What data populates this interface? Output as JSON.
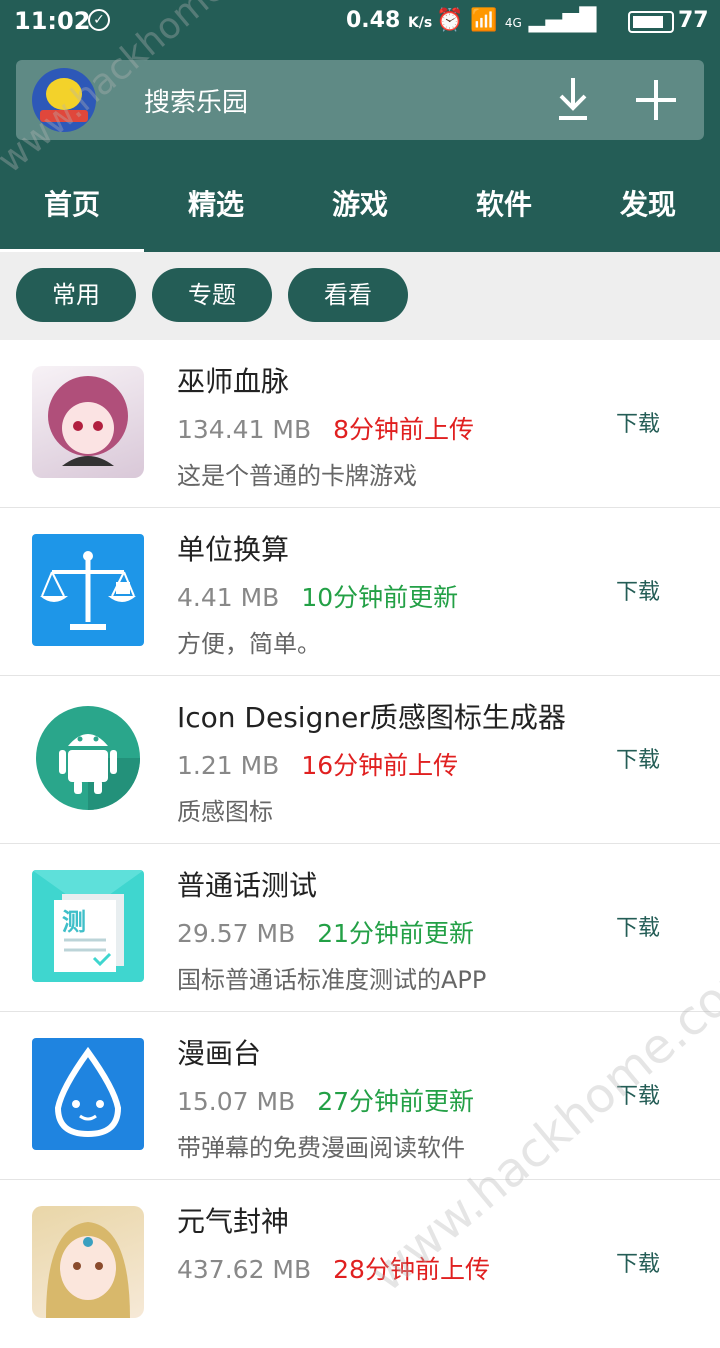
{
  "status_bar": {
    "time": "11:02",
    "speed": "0.48",
    "speed_unit": "K/s",
    "network": "4G",
    "battery": "77"
  },
  "header": {
    "search_placeholder": "搜索乐园",
    "avatar_text": "教我们爱玩"
  },
  "tabs": [
    {
      "label": "首页",
      "active": true
    },
    {
      "label": "精选",
      "active": false
    },
    {
      "label": "游戏",
      "active": false
    },
    {
      "label": "软件",
      "active": false
    },
    {
      "label": "发现",
      "active": false
    }
  ],
  "chips": [
    {
      "label": "常用"
    },
    {
      "label": "专题"
    },
    {
      "label": "看看"
    }
  ],
  "apps": [
    {
      "name": "巫师血脉",
      "size": "134.41 MB",
      "time": "8分钟前上传",
      "time_color": "#e02020",
      "desc": "这是个普通的卡牌游戏",
      "download": "下载",
      "icon": "anime-girl-icon"
    },
    {
      "name": "单位换算",
      "size": "4.41 MB",
      "time": "10分钟前更新",
      "time_color": "#23a046",
      "desc": "方便，简单。",
      "download": "下载",
      "icon": "scale-icon"
    },
    {
      "name": "Icon Designer质感图标生成器",
      "size": "1.21 MB",
      "time": "16分钟前上传",
      "time_color": "#e02020",
      "desc": "质感图标",
      "download": "下载",
      "icon": "android-icon"
    },
    {
      "name": "普通话测试",
      "size": "29.57 MB",
      "time": "21分钟前更新",
      "time_color": "#23a046",
      "desc": "国标普通话标准度测试的APP",
      "download": "下载",
      "icon": "test-document-icon",
      "icon_text": "测"
    },
    {
      "name": "漫画台",
      "size": "15.07 MB",
      "time": "27分钟前更新",
      "time_color": "#23a046",
      "desc": "带弹幕的免费漫画阅读软件",
      "download": "下载",
      "icon": "water-drop-mascot-icon"
    },
    {
      "name": "元气封神",
      "size": "437.62 MB",
      "time": "28分钟前上传",
      "time_color": "#e02020",
      "desc": "",
      "download": "下载",
      "icon": "anime-character-icon"
    }
  ],
  "watermark": "www.hackhome.com",
  "colors": {
    "primary": "#245d56",
    "red": "#e02020",
    "green": "#23a046"
  }
}
